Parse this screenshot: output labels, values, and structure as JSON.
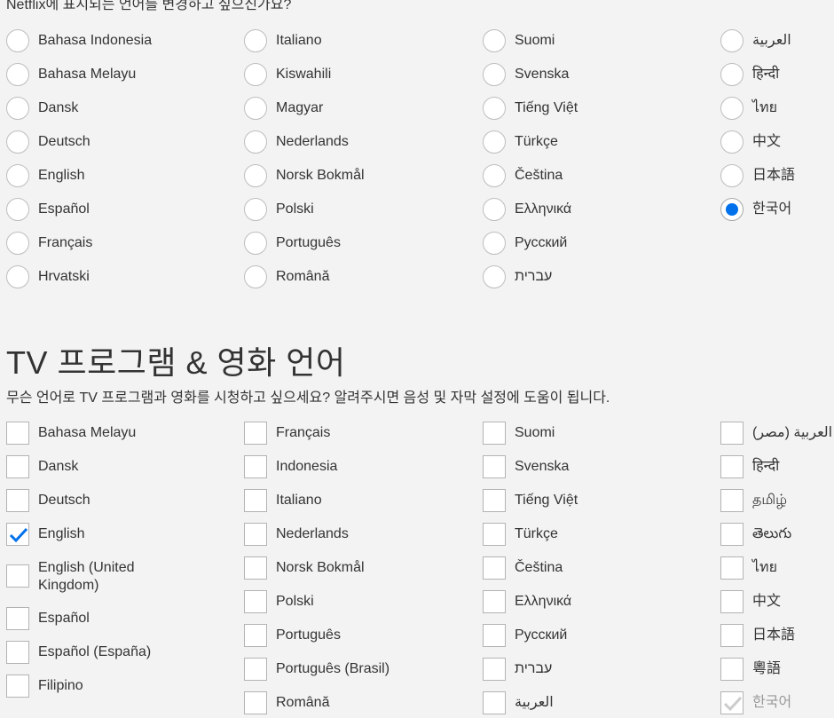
{
  "display_language": {
    "prompt": "Netflix에 표시되는 언어를 변경하고 싶으신가요?",
    "selected": "한국어",
    "columns": [
      [
        "Bahasa Indonesia",
        "Bahasa Melayu",
        "Dansk",
        "Deutsch",
        "English",
        "Español",
        "Français",
        "Hrvatski"
      ],
      [
        "Italiano",
        "Kiswahili",
        "Magyar",
        "Nederlands",
        "Norsk Bokmål",
        "Polski",
        "Português",
        "Română"
      ],
      [
        "Suomi",
        "Svenska",
        "Tiếng Việt",
        "Türkçe",
        "Čeština",
        "Ελληνικά",
        "Русский",
        "עברית"
      ],
      [
        "العربية",
        "हिन्दी",
        "ไทย",
        "中文",
        "日本語",
        "한국어"
      ]
    ]
  },
  "content_language": {
    "title": "TV 프로그램 & 영화 언어",
    "description": "무슨 언어로 TV 프로그램과 영화를 시청하고 싶으세요? 알려주시면 음성 및 자막 설정에 도움이 됩니다.",
    "columns": [
      [
        "Bahasa Melayu",
        "Dansk",
        "Deutsch",
        "English",
        "English (United Kingdom)",
        "Español",
        "Español (España)",
        "Filipino"
      ],
      [
        "Français",
        "Indonesia",
        "Italiano",
        "Nederlands",
        "Norsk Bokmål",
        "Polski",
        "Português",
        "Português (Brasil)",
        "Română"
      ],
      [
        "Suomi",
        "Svenska",
        "Tiếng Việt",
        "Türkçe",
        "Čeština",
        "Ελληνικά",
        "Русский",
        "עברית",
        "العربية"
      ],
      [
        "العربية (مصر)",
        "हिन्दी",
        "தமிழ்",
        "తెలుగు",
        "ไทย",
        "中文",
        "日本語",
        "粵語",
        "한국어"
      ]
    ],
    "checked": [
      "English",
      "한국어"
    ],
    "disabled": [
      "한국어"
    ]
  },
  "colors": {
    "accent": "#0071eb",
    "background": "#f3f3f3",
    "disabled_check": "#cccccc"
  }
}
